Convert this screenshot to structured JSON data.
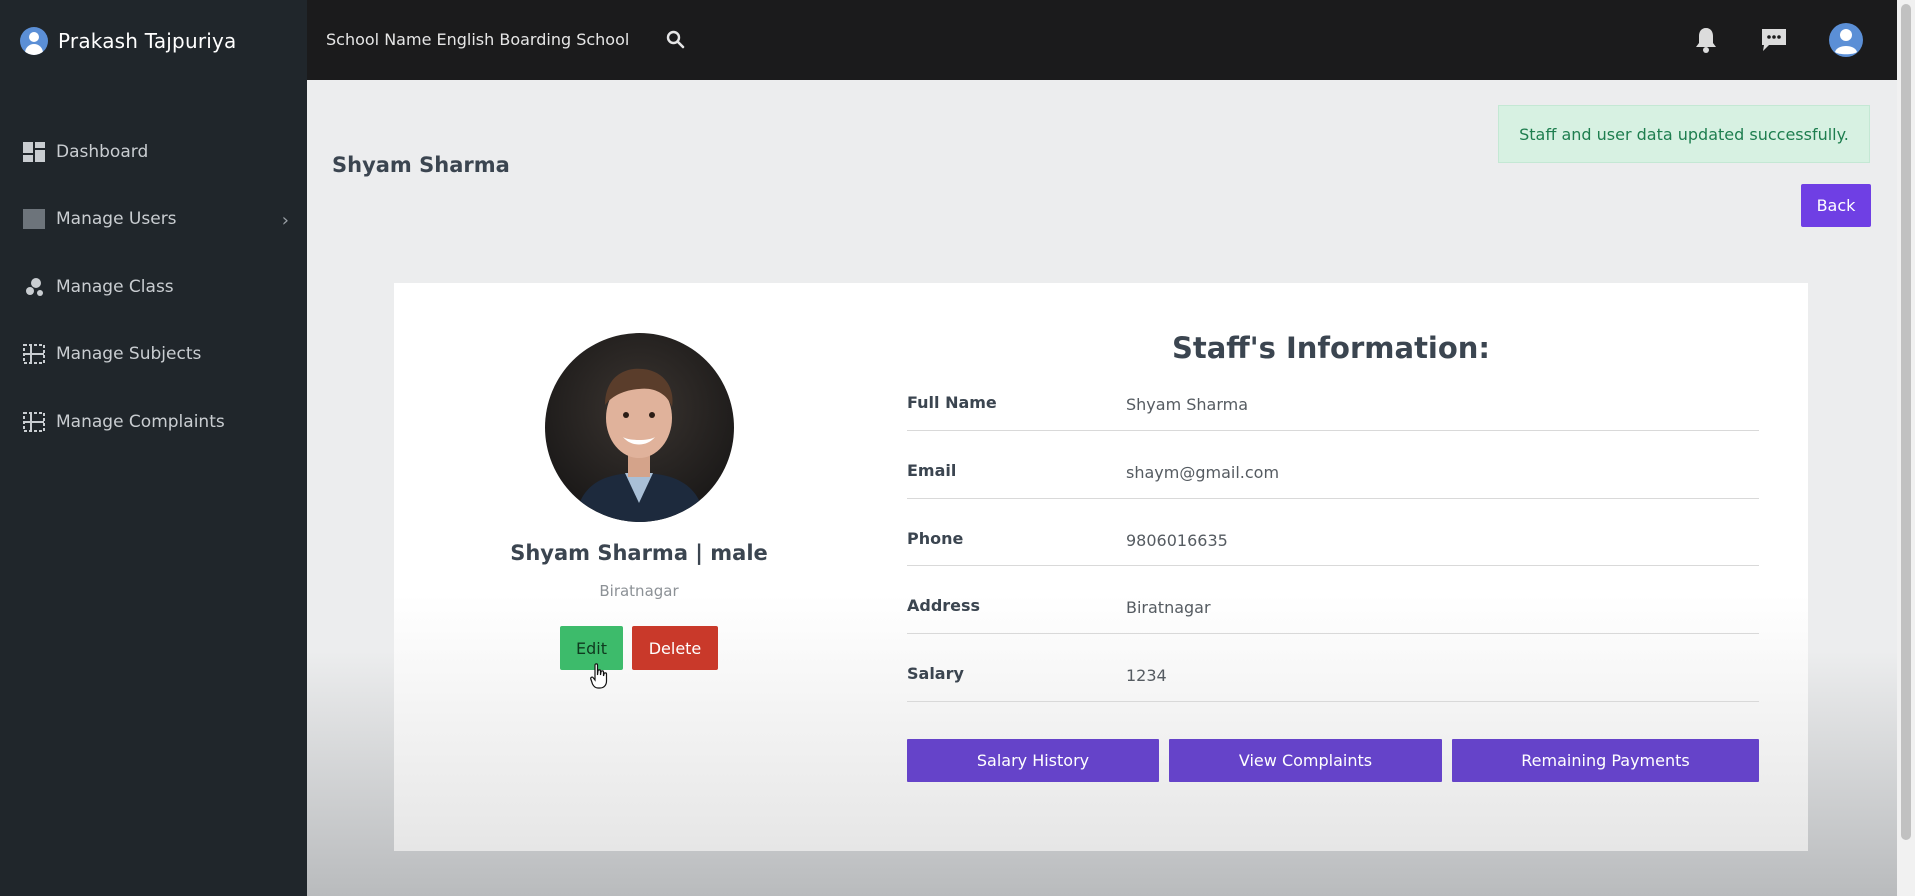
{
  "sidebar": {
    "user_name": "Prakash Tajpuriya",
    "items": [
      {
        "label": "Dashboard",
        "icon": "dashboard-icon"
      },
      {
        "label": "Manage Users",
        "icon": "users-icon",
        "has_submenu": true
      },
      {
        "label": "Manage Class",
        "icon": "class-icon"
      },
      {
        "label": "Manage Subjects",
        "icon": "subjects-icon"
      },
      {
        "label": "Manage Complaints",
        "icon": "complaints-icon"
      }
    ]
  },
  "topbar": {
    "school_name": "School Name English Boarding School",
    "icons": [
      "search-icon",
      "bell-icon",
      "message-icon",
      "user-avatar-icon"
    ]
  },
  "main": {
    "page_title": "Shyam Sharma",
    "alert": "Staff and user data updated successfully.",
    "back_label": "Back"
  },
  "profile": {
    "name_line": "Shyam Sharma | male",
    "location": "Biratnagar",
    "edit_label": "Edit",
    "delete_label": "Delete"
  },
  "info": {
    "title": "Staff's Information:",
    "rows": [
      {
        "label": "Full Name",
        "value": "Shyam Sharma"
      },
      {
        "label": "Email",
        "value": "shaym@gmail.com"
      },
      {
        "label": "Phone",
        "value": "9806016635"
      },
      {
        "label": "Address",
        "value": "Biratnagar"
      },
      {
        "label": "Salary",
        "value": "1234"
      }
    ],
    "buttons": {
      "salary_history": "Salary History",
      "view_complaints": "View Complaints",
      "remaining_payments": "Remaining Payments"
    }
  },
  "colors": {
    "sidebar_bg": "#20262b",
    "topbar_bg": "#1b1b1c",
    "primary": "#6543c9",
    "back": "#6f3fe4",
    "success": "#3dbb6b",
    "danger": "#c9392a",
    "alert_bg": "#d7f1e2"
  }
}
